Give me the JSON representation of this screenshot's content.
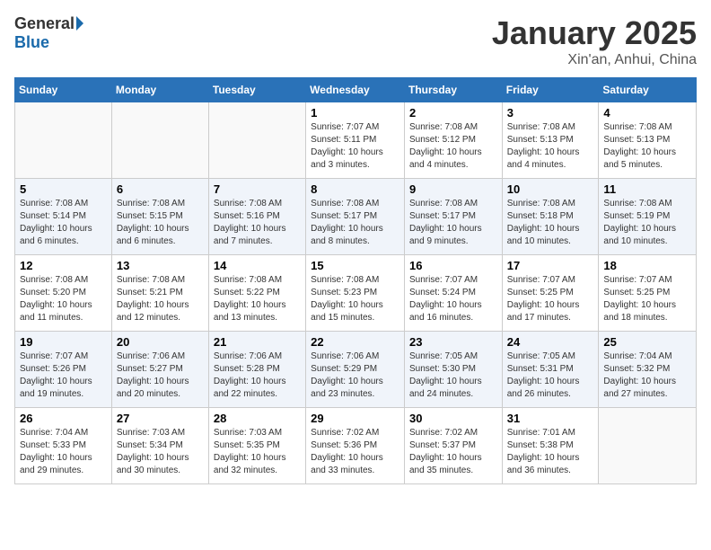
{
  "header": {
    "logo_general": "General",
    "logo_blue": "Blue",
    "title": "January 2025",
    "subtitle": "Xin'an, Anhui, China"
  },
  "days_of_week": [
    "Sunday",
    "Monday",
    "Tuesday",
    "Wednesday",
    "Thursday",
    "Friday",
    "Saturday"
  ],
  "weeks": [
    [
      {
        "day": "",
        "sunrise": "",
        "sunset": "",
        "daylight": ""
      },
      {
        "day": "",
        "sunrise": "",
        "sunset": "",
        "daylight": ""
      },
      {
        "day": "",
        "sunrise": "",
        "sunset": "",
        "daylight": ""
      },
      {
        "day": "1",
        "sunrise": "Sunrise: 7:07 AM",
        "sunset": "Sunset: 5:11 PM",
        "daylight": "Daylight: 10 hours and 3 minutes."
      },
      {
        "day": "2",
        "sunrise": "Sunrise: 7:08 AM",
        "sunset": "Sunset: 5:12 PM",
        "daylight": "Daylight: 10 hours and 4 minutes."
      },
      {
        "day": "3",
        "sunrise": "Sunrise: 7:08 AM",
        "sunset": "Sunset: 5:13 PM",
        "daylight": "Daylight: 10 hours and 4 minutes."
      },
      {
        "day": "4",
        "sunrise": "Sunrise: 7:08 AM",
        "sunset": "Sunset: 5:13 PM",
        "daylight": "Daylight: 10 hours and 5 minutes."
      }
    ],
    [
      {
        "day": "5",
        "sunrise": "Sunrise: 7:08 AM",
        "sunset": "Sunset: 5:14 PM",
        "daylight": "Daylight: 10 hours and 6 minutes."
      },
      {
        "day": "6",
        "sunrise": "Sunrise: 7:08 AM",
        "sunset": "Sunset: 5:15 PM",
        "daylight": "Daylight: 10 hours and 6 minutes."
      },
      {
        "day": "7",
        "sunrise": "Sunrise: 7:08 AM",
        "sunset": "Sunset: 5:16 PM",
        "daylight": "Daylight: 10 hours and 7 minutes."
      },
      {
        "day": "8",
        "sunrise": "Sunrise: 7:08 AM",
        "sunset": "Sunset: 5:17 PM",
        "daylight": "Daylight: 10 hours and 8 minutes."
      },
      {
        "day": "9",
        "sunrise": "Sunrise: 7:08 AM",
        "sunset": "Sunset: 5:17 PM",
        "daylight": "Daylight: 10 hours and 9 minutes."
      },
      {
        "day": "10",
        "sunrise": "Sunrise: 7:08 AM",
        "sunset": "Sunset: 5:18 PM",
        "daylight": "Daylight: 10 hours and 10 minutes."
      },
      {
        "day": "11",
        "sunrise": "Sunrise: 7:08 AM",
        "sunset": "Sunset: 5:19 PM",
        "daylight": "Daylight: 10 hours and 10 minutes."
      }
    ],
    [
      {
        "day": "12",
        "sunrise": "Sunrise: 7:08 AM",
        "sunset": "Sunset: 5:20 PM",
        "daylight": "Daylight: 10 hours and 11 minutes."
      },
      {
        "day": "13",
        "sunrise": "Sunrise: 7:08 AM",
        "sunset": "Sunset: 5:21 PM",
        "daylight": "Daylight: 10 hours and 12 minutes."
      },
      {
        "day": "14",
        "sunrise": "Sunrise: 7:08 AM",
        "sunset": "Sunset: 5:22 PM",
        "daylight": "Daylight: 10 hours and 13 minutes."
      },
      {
        "day": "15",
        "sunrise": "Sunrise: 7:08 AM",
        "sunset": "Sunset: 5:23 PM",
        "daylight": "Daylight: 10 hours and 15 minutes."
      },
      {
        "day": "16",
        "sunrise": "Sunrise: 7:07 AM",
        "sunset": "Sunset: 5:24 PM",
        "daylight": "Daylight: 10 hours and 16 minutes."
      },
      {
        "day": "17",
        "sunrise": "Sunrise: 7:07 AM",
        "sunset": "Sunset: 5:25 PM",
        "daylight": "Daylight: 10 hours and 17 minutes."
      },
      {
        "day": "18",
        "sunrise": "Sunrise: 7:07 AM",
        "sunset": "Sunset: 5:25 PM",
        "daylight": "Daylight: 10 hours and 18 minutes."
      }
    ],
    [
      {
        "day": "19",
        "sunrise": "Sunrise: 7:07 AM",
        "sunset": "Sunset: 5:26 PM",
        "daylight": "Daylight: 10 hours and 19 minutes."
      },
      {
        "day": "20",
        "sunrise": "Sunrise: 7:06 AM",
        "sunset": "Sunset: 5:27 PM",
        "daylight": "Daylight: 10 hours and 20 minutes."
      },
      {
        "day": "21",
        "sunrise": "Sunrise: 7:06 AM",
        "sunset": "Sunset: 5:28 PM",
        "daylight": "Daylight: 10 hours and 22 minutes."
      },
      {
        "day": "22",
        "sunrise": "Sunrise: 7:06 AM",
        "sunset": "Sunset: 5:29 PM",
        "daylight": "Daylight: 10 hours and 23 minutes."
      },
      {
        "day": "23",
        "sunrise": "Sunrise: 7:05 AM",
        "sunset": "Sunset: 5:30 PM",
        "daylight": "Daylight: 10 hours and 24 minutes."
      },
      {
        "day": "24",
        "sunrise": "Sunrise: 7:05 AM",
        "sunset": "Sunset: 5:31 PM",
        "daylight": "Daylight: 10 hours and 26 minutes."
      },
      {
        "day": "25",
        "sunrise": "Sunrise: 7:04 AM",
        "sunset": "Sunset: 5:32 PM",
        "daylight": "Daylight: 10 hours and 27 minutes."
      }
    ],
    [
      {
        "day": "26",
        "sunrise": "Sunrise: 7:04 AM",
        "sunset": "Sunset: 5:33 PM",
        "daylight": "Daylight: 10 hours and 29 minutes."
      },
      {
        "day": "27",
        "sunrise": "Sunrise: 7:03 AM",
        "sunset": "Sunset: 5:34 PM",
        "daylight": "Daylight: 10 hours and 30 minutes."
      },
      {
        "day": "28",
        "sunrise": "Sunrise: 7:03 AM",
        "sunset": "Sunset: 5:35 PM",
        "daylight": "Daylight: 10 hours and 32 minutes."
      },
      {
        "day": "29",
        "sunrise": "Sunrise: 7:02 AM",
        "sunset": "Sunset: 5:36 PM",
        "daylight": "Daylight: 10 hours and 33 minutes."
      },
      {
        "day": "30",
        "sunrise": "Sunrise: 7:02 AM",
        "sunset": "Sunset: 5:37 PM",
        "daylight": "Daylight: 10 hours and 35 minutes."
      },
      {
        "day": "31",
        "sunrise": "Sunrise: 7:01 AM",
        "sunset": "Sunset: 5:38 PM",
        "daylight": "Daylight: 10 hours and 36 minutes."
      },
      {
        "day": "",
        "sunrise": "",
        "sunset": "",
        "daylight": ""
      }
    ]
  ]
}
